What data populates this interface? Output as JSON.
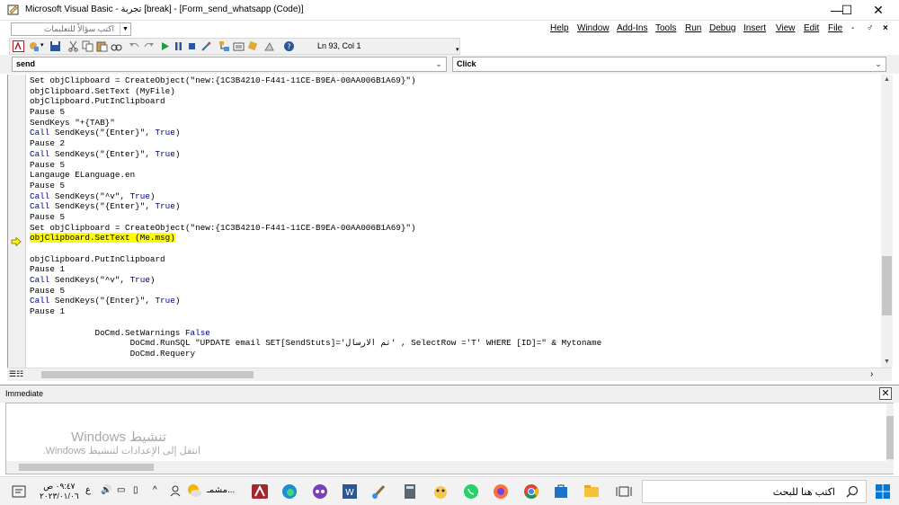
{
  "window": {
    "title": "Microsoft Visual Basic - تجربة [break] - [Form_send_whatsapp (Code)]",
    "controls": {
      "minimize": "—",
      "maximize": "☐",
      "close": "✕"
    }
  },
  "menubar": {
    "help_placeholder": "اكتب سؤالاً للتعليمات",
    "items": [
      "Help",
      "Window",
      "Add-Ins",
      "Tools",
      "Run",
      "Debug",
      "Insert",
      "View",
      "Edit",
      "File"
    ],
    "mdi_controls": [
      "-",
      "♂",
      "×"
    ]
  },
  "toolbar": {
    "position_readout": "Ln 93, Col 1"
  },
  "objectbar": {
    "object": "send",
    "procedure": "Click"
  },
  "code": {
    "current_line_index": 15,
    "lines": [
      [
        {
          "t": "Set objClipboard = CreateObject(\"new:{1C3B4210-F441-11CE-B9EA-00AA006B1A69}\")"
        }
      ],
      [
        {
          "t": "objClipboard.SetText (MyFile)"
        }
      ],
      [
        {
          "t": "objClipboard.PutInClipboard"
        }
      ],
      [
        {
          "t": "Pause 5"
        }
      ],
      [
        {
          "t": "SendKeys \"+{TAB}\""
        }
      ],
      [
        {
          "t": "Call",
          "k": 1
        },
        {
          "t": " SendKeys(\"{Enter}\", "
        },
        {
          "t": "True",
          "k": 1
        },
        {
          "t": ")"
        }
      ],
      [
        {
          "t": "Pause 2"
        }
      ],
      [
        {
          "t": "Call",
          "k": 1
        },
        {
          "t": " SendKeys(\"{Enter}\", "
        },
        {
          "t": "True",
          "k": 1
        },
        {
          "t": ")"
        }
      ],
      [
        {
          "t": "Pause 5"
        }
      ],
      [
        {
          "t": "Langauge ELanguage.en"
        }
      ],
      [
        {
          "t": "Pause 5"
        }
      ],
      [
        {
          "t": "Call",
          "k": 1
        },
        {
          "t": " SendKeys(\"^v\", "
        },
        {
          "t": "True",
          "k": 1
        },
        {
          "t": ")"
        }
      ],
      [
        {
          "t": "Call",
          "k": 1
        },
        {
          "t": " SendKeys(\"{Enter}\", "
        },
        {
          "t": "True",
          "k": 1
        },
        {
          "t": ")"
        }
      ],
      [
        {
          "t": "Pause 5"
        }
      ],
      [
        {
          "t": "Set objClipboard = CreateObject(\"new:{1C3B4210-F441-11CE-B9EA-00AA006B1A69}\")"
        }
      ],
      [
        {
          "t": "objClipboard.SetText (Me.msg)",
          "h": 1
        }
      ],
      [
        {
          "t": ""
        }
      ],
      [
        {
          "t": "objClipboard.PutInClipboard"
        }
      ],
      [
        {
          "t": "Pause 1"
        }
      ],
      [
        {
          "t": "Call",
          "k": 1
        },
        {
          "t": " SendKeys(\"^v\", "
        },
        {
          "t": "True",
          "k": 1
        },
        {
          "t": ")"
        }
      ],
      [
        {
          "t": "Pause 5"
        }
      ],
      [
        {
          "t": "Call",
          "k": 1
        },
        {
          "t": " SendKeys(\"{Enter}\", "
        },
        {
          "t": "True",
          "k": 1
        },
        {
          "t": ")"
        }
      ],
      [
        {
          "t": "Pause 1"
        }
      ],
      [
        {
          "t": ""
        }
      ],
      [
        {
          "t": "             DoCmd.SetWarnings "
        },
        {
          "t": "False",
          "k": 1
        }
      ],
      [
        {
          "t": "                    DoCmd.RunSQL \"UPDATE email SET[SendStuts]='تم الارسال' , SelectRow ='T' WHERE [ID]=\" & Mytoname"
        }
      ],
      [
        {
          "t": "                    DoCmd.Requery"
        }
      ]
    ]
  },
  "immediate": {
    "title": "Immediate",
    "close": "✕",
    "watermark_title": "تنشيط Windows",
    "watermark_sub": "انتقل إلى الإعدادات لتنشيط Windows."
  },
  "taskbar": {
    "search_placeholder": "اكتب هنا للبحث",
    "clock_time": "٠٩:٤٧ ص",
    "clock_date": "٢٠٢٣/٠١/٠٦",
    "lang": "ع",
    "weather_label": "مشمـ...",
    "accent": "#0078d7"
  },
  "colors": {
    "keyword": "#00008b",
    "highlight": "#ffff00"
  }
}
